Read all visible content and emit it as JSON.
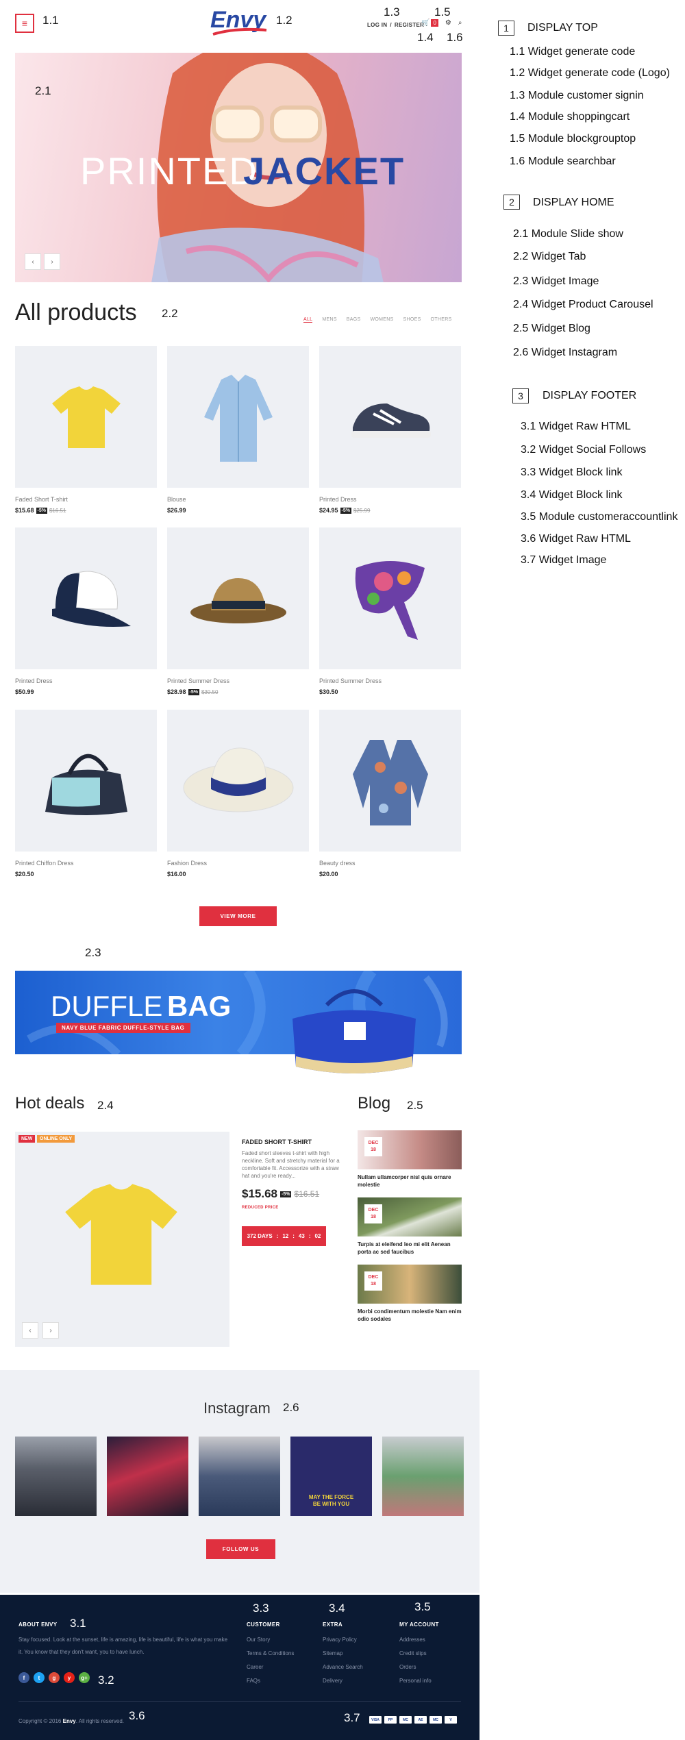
{
  "site": {
    "brand": "Envy",
    "menu_icon": "hamburger-icon",
    "toplinks": {
      "login": "LOG IN",
      "sep": "/",
      "register": "REGISTER"
    },
    "cart_count": "0",
    "hero": {
      "word1": "PRINTED",
      "word2": "JACKET",
      "prev": "‹",
      "next": "›"
    },
    "products_title": "All products",
    "tabs": [
      "ALL",
      "MENS",
      "BAGS",
      "WOMENS",
      "SHOES",
      "OTHERS"
    ],
    "products": [
      {
        "name": "Faded Short T-shirt",
        "price": "$15.68",
        "badge": "-5%",
        "old": "$16.51"
      },
      {
        "name": "Blouse",
        "price": "$26.99",
        "badge": "",
        "old": ""
      },
      {
        "name": "Printed Dress",
        "price": "$24.95",
        "badge": "-5%",
        "old": "$25.99"
      },
      {
        "name": "Printed Dress",
        "price": "$50.99",
        "badge": "",
        "old": ""
      },
      {
        "name": "Printed Summer Dress",
        "price": "$28.98",
        "badge": "-5%",
        "old": "$30.50"
      },
      {
        "name": "Printed Summer Dress",
        "price": "$30.50",
        "badge": "",
        "old": ""
      },
      {
        "name": "Printed Chiffon Dress",
        "price": "$20.50",
        "badge": "",
        "old": ""
      },
      {
        "name": "Fashion Dress",
        "price": "$16.00",
        "badge": "",
        "old": ""
      },
      {
        "name": "Beauty dress",
        "price": "$20.00",
        "badge": "",
        "old": ""
      }
    ],
    "view_more": "VIEW MORE",
    "banner": {
      "word1": "DUFFLE",
      "word2": "BAG",
      "sub": "NAVY BLUE FABRIC DUFFLE-STYLE BAG"
    },
    "hot_deals": {
      "title": "Hot deals",
      "tag_new": "NEW",
      "tag_online": "ONLINE ONLY",
      "name": "FADED SHORT T-SHIRT",
      "desc": "Faded short sleeves t-shirt with high neckline. Soft and stretchy material for a comfortable fit. Accessorize with a straw hat and you're ready...",
      "price": "$15.68",
      "badge": "-5%",
      "old": "$16.51",
      "reduced": "REDUCED PRICE",
      "countdown": {
        "days": "372 DAYS",
        "h": "12",
        "m": "43",
        "s": "02",
        "sep": ":"
      },
      "prev": "‹",
      "next": "›"
    },
    "blog": {
      "title": "Blog",
      "posts": [
        {
          "month": "DEC",
          "day": "18",
          "title": "Nullam ullamcorper nisl quis ornare molestie"
        },
        {
          "month": "DEC",
          "day": "18",
          "title": "Turpis at eleifend leo mi elit Aenean porta ac sed faucibus"
        },
        {
          "month": "DEC",
          "day": "18",
          "title": "Morbi condimentum molestie Nam enim odio sodales"
        }
      ]
    },
    "instagram": {
      "title": "Instagram",
      "follow": "FOLLOW US",
      "photo4_text1": "MAY THE FORCE",
      "photo4_text2": "BE WITH YOU"
    },
    "footer": {
      "about_title": "ABOUT ENVY",
      "about_text1": "Stay focused. Look at the sunset, life is amazing, life is beautiful, life is what you make",
      "about_text2": "it. You know that they don't want, you to have lunch.",
      "social": [
        "f",
        "t",
        "g",
        "y",
        "g+"
      ],
      "customer_title": "CUSTOMER",
      "customer_links": [
        "Our Story",
        "Terms & Conditions",
        "Career",
        "FAQs"
      ],
      "extra_title": "EXTRA",
      "extra_links": [
        "Privacy Policy",
        "Sitemap",
        "Advance Search",
        "Delivery"
      ],
      "account_title": "MY ACCOUNT",
      "account_links": [
        "Addresses",
        "Credit slips",
        "Orders",
        "Personal info"
      ],
      "copyright_pre": "Copyright © 2016",
      "copyright_brand": "Envy",
      "copyright_post": ". All rights reserved.",
      "payments": [
        "VISA",
        "PP",
        "MC",
        "AE",
        "MC",
        "V"
      ]
    },
    "annotations": {
      "a11": "1.1",
      "a12": "1.2",
      "a13": "1.3",
      "a14": "1.4",
      "a15": "1.5",
      "a16": "1.6",
      "a21": "2.1",
      "a22": "2.2",
      "a23": "2.3",
      "a24": "2.4",
      "a25": "2.5",
      "a26": "2.6",
      "a31": "3.1",
      "a32": "3.2",
      "a33": "3.3",
      "a34": "3.4",
      "a35": "3.5",
      "a36": "3.6",
      "a37": "3.7"
    }
  },
  "panel": {
    "sections": [
      {
        "num": "1",
        "title": "DISPLAY TOP",
        "items": [
          "1.1 Widget generate code",
          "1.2 Widget generate code (Logo)",
          "1.3 Module customer signin",
          "1.4 Module shoppingcart",
          "1.5 Module blockgrouptop",
          "1.6 Module searchbar"
        ]
      },
      {
        "num": "2",
        "title": "DISPLAY HOME",
        "items": [
          "2.1 Module Slide show",
          "2.2 Widget Tab",
          "2.3 Widget Image",
          "2.4 Widget Product Carousel",
          "2.5 Widget Blog",
          "2.6 Widget Instagram"
        ]
      },
      {
        "num": "3",
        "title": "DISPLAY FOOTER",
        "items": [
          "3.1 Widget Raw HTML",
          "3.2 Widget Social Follows",
          "3.3 Widget Block link",
          "3.4 Widget Block link",
          "3.5 Module customeraccountlink",
          "3.6 Widget Raw HTML",
          "3.7 Widget Image"
        ]
      }
    ]
  }
}
